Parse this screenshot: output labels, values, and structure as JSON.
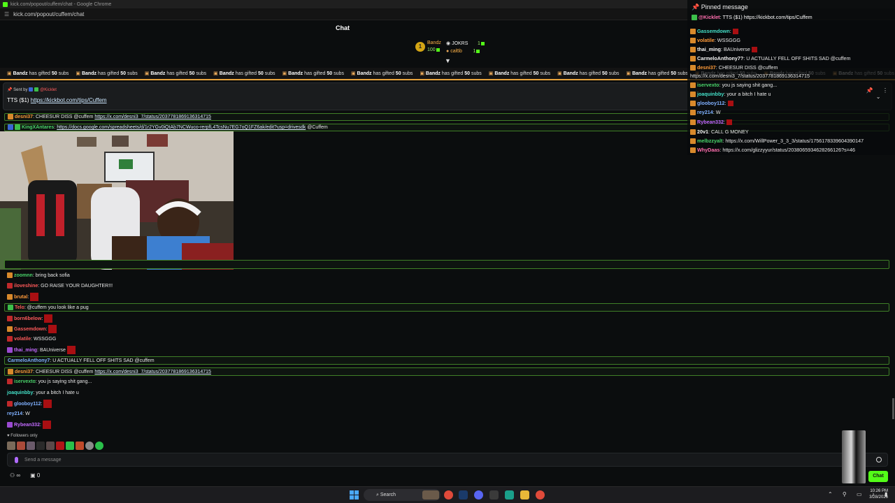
{
  "browser": {
    "title": "kick.com/popout/cuffem/chat - Google Chrome",
    "url": "kick.com/popout/cuffem/chat"
  },
  "header": {
    "title": "Chat"
  },
  "leaderboard": {
    "rank": "1",
    "top_name": "Bandz",
    "top_amount": "100",
    "entries": [
      {
        "name": "JOKRS",
        "count": "1"
      },
      {
        "name": "cal6b",
        "count": "1"
      }
    ]
  },
  "ticker": {
    "gifter": "Bandz",
    "text_mid": "has gifted",
    "amount": "50",
    "text_end": "subs"
  },
  "pinned_bar": {
    "sent_by_label": "Sent by",
    "sender": "@Kicklet",
    "message_prefix": "TTS ($1)",
    "message_link": "https://kickbot.com/tips/Cuffem"
  },
  "messages_top": [
    {
      "user": "desni37",
      "text": "CHEESUR DISS @cuffem",
      "link": "https://x.com/desni3_7/status/2037781869136314715"
    },
    {
      "user": "KingXAntares",
      "text": "",
      "link": "https://docs.google.com/spreadsheets/d/1r2YGv0iQtAb7NCWuco-rerpfL4TcsNu7EG7oQ1FZ6ak/edit?usp=drivesdk",
      "suffix": "@Cuffem"
    }
  ],
  "messages": [
    {
      "user": "zoomnn",
      "text": "bring back sofia"
    },
    {
      "user": "iloveshine",
      "text": "GO RAISE YOUR DAUGHTER!!!"
    },
    {
      "user": "brutal",
      "text": ""
    },
    {
      "user": "Telo",
      "text": "@cuffem you look like a pug"
    },
    {
      "user": "born6below",
      "text": ""
    },
    {
      "user": "Gassemdown",
      "text": ""
    },
    {
      "user": "volatile",
      "text": "WSSGGG"
    },
    {
      "user": "thai_ming",
      "text": "BAUniverse"
    },
    {
      "user": "CarmeloAnthony7",
      "text": "U ACTUALLY FELL OFF SHITS SAD",
      "suffix": "@cuffem"
    },
    {
      "user": "desni37",
      "text": "CHEESUR DISS @cuffem",
      "link": "https://x.com/desni3_7/status/2037781869136314715"
    },
    {
      "user": "iservexto",
      "text": "you js saying shit gang..."
    },
    {
      "user": "joaquinbby",
      "text": "your a bitch I hate u"
    },
    {
      "user": "glooboy112",
      "text": ""
    },
    {
      "user": "rey214",
      "text": "W"
    },
    {
      "user": "Rybean332",
      "text": ""
    }
  ],
  "followers_only_label": "Followers only",
  "input": {
    "placeholder": "Send a message"
  },
  "stats": {
    "viewers": "∞",
    "gifts": "0"
  },
  "chat_button": "Chat",
  "overlay": {
    "title": "Pinned message",
    "pin_sender": "@Kicklet",
    "pin_text": "TTS ($1)",
    "pin_link": "https://kickbot.com/tips/Cuffem",
    "lines": [
      {
        "user": "Gassemdown",
        "text": ""
      },
      {
        "user": "volatile",
        "text": "WSSGGG"
      },
      {
        "user": "thai_ming",
        "text": "BAUniverse"
      },
      {
        "user": "CarmeloAnthony7?",
        "text": "U ACTUALLY FELL OFF SHITS SAD",
        "suffix": "@cuffem"
      },
      {
        "user": "desni37",
        "text": "CHEESUR DISS @cuffem"
      },
      {
        "user": "",
        "text": "https://x.com/desni3_7/status/2037781869136314715"
      },
      {
        "user": "iservexto",
        "text": "you js saying shit gang..."
      },
      {
        "user": "joaquinbby",
        "text": "your a bitch I hate u"
      },
      {
        "user": "glooboy112",
        "text": ""
      },
      {
        "user": "rey214",
        "text": "W"
      },
      {
        "user": "Rybean332",
        "text": ""
      },
      {
        "user": "20v1",
        "text": "CALL G MONEY"
      },
      {
        "user": "melbzzyalt",
        "text": "https://x.com/WillPower_3_3_3/status/1756178339604390147"
      },
      {
        "user": "WhyDaas",
        "text": "https://x.com/glizzyyur/status/2038065934628266126?s=46"
      }
    ]
  },
  "taskbar": {
    "search_label": "Search",
    "time": "10:26 PM",
    "date": "3/28/2026"
  },
  "colors": {
    "accent": "#53fc18",
    "ticker_line": "#e6a23c"
  }
}
